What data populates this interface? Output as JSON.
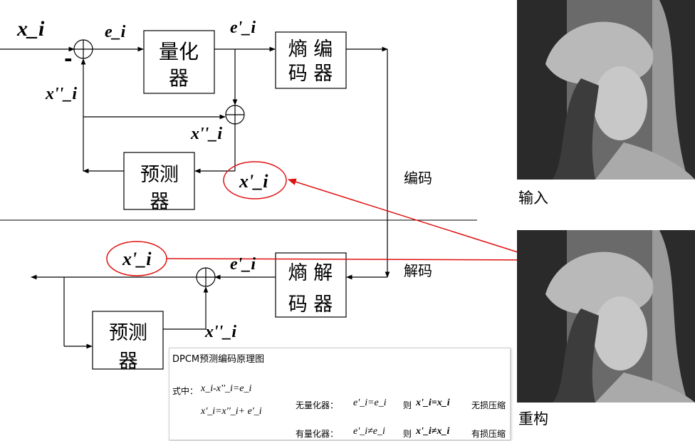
{
  "encoder": {
    "input_label": "x_i",
    "error_label": "e_i",
    "minus_sign": "-",
    "quantized_label": "e'_i",
    "feedback_label": "x''_i",
    "pred_label": "x''_i",
    "recon_label": "x'_i",
    "quantizer": [
      "量化",
      "器"
    ],
    "entropy_coder": [
      "熵 编",
      "码 器"
    ],
    "predictor": [
      "预测",
      "器"
    ]
  },
  "decoder": {
    "output_label": "x'_i",
    "input_label": "e'_i",
    "pred_label": "x''_i",
    "entropy_decoder": [
      "熵 解",
      "码 器"
    ],
    "predictor": [
      "预测",
      "器"
    ]
  },
  "channel": {
    "encode_label": "编码",
    "decode_label": "解码"
  },
  "images": {
    "input_caption": "输入",
    "output_caption": "重构"
  },
  "note": {
    "title": "DPCM预测编码原理图",
    "prefix": "式中：",
    "eq1": "x_i-x''_i=e_i",
    "eq2": "x'_i=x''_i+ e'_i",
    "row1": {
      "label": "无量化器：",
      "eq": "e'_i=e_i",
      "then": "则",
      "result": "x'_i=x_i",
      "type": "无损压缩"
    },
    "row2": {
      "label": "有量化器：",
      "eq": "e'_i≠e_i",
      "then": "则",
      "result": "x'_i≠x_i",
      "type": "有损压缩"
    }
  },
  "colors": {
    "highlight": "#e01010",
    "line": "#000000"
  }
}
